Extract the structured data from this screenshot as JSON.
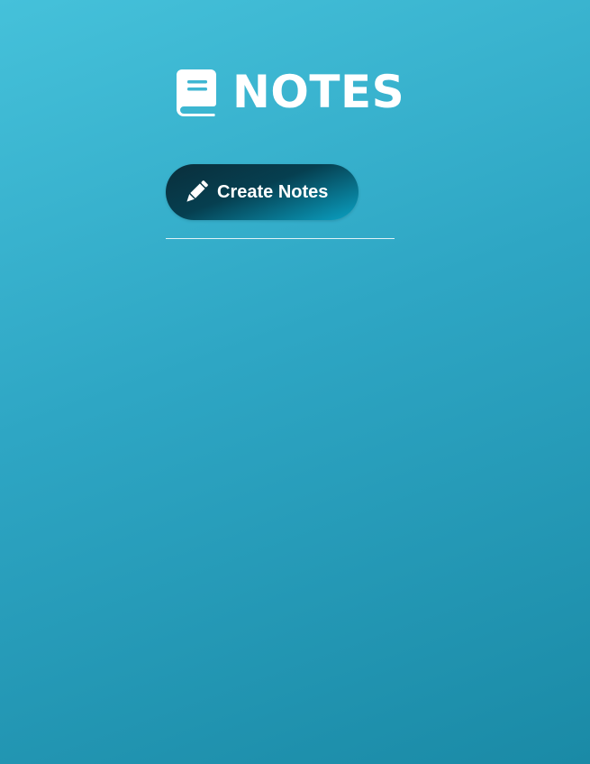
{
  "header": {
    "title": "NOTES",
    "icon": "book-icon"
  },
  "actions": {
    "create_label": "Create Notes",
    "create_icon": "pencil-icon"
  },
  "notes": [],
  "colors": {
    "background_start": "#45c1da",
    "background_end": "#1a8aa6",
    "button_dark": "#0a2e3b",
    "button_light": "#0aa2c4",
    "text": "#ffffff"
  }
}
